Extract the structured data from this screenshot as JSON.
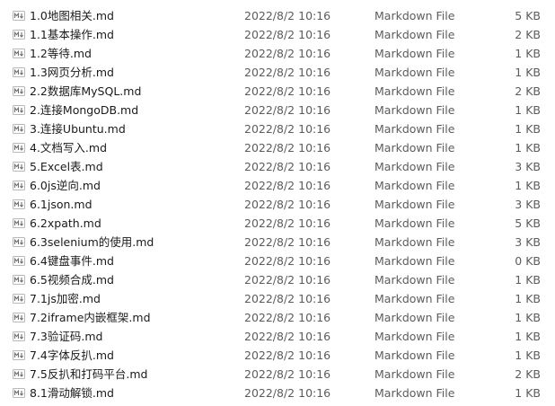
{
  "file_list": {
    "icon": "markdown-file-icon",
    "files": [
      {
        "name": "1.0地图相关.md",
        "modified": "2022/8/2 10:16",
        "type": "Markdown File",
        "size": "5 KB"
      },
      {
        "name": "1.1基本操作.md",
        "modified": "2022/8/2 10:16",
        "type": "Markdown File",
        "size": "2 KB"
      },
      {
        "name": "1.2等待.md",
        "modified": "2022/8/2 10:16",
        "type": "Markdown File",
        "size": "1 KB"
      },
      {
        "name": "1.3网页分析.md",
        "modified": "2022/8/2 10:16",
        "type": "Markdown File",
        "size": "1 KB"
      },
      {
        "name": "2.2数据库MySQL.md",
        "modified": "2022/8/2 10:16",
        "type": "Markdown File",
        "size": "2 KB"
      },
      {
        "name": "2.连接MongoDB.md",
        "modified": "2022/8/2 10:16",
        "type": "Markdown File",
        "size": "1 KB"
      },
      {
        "name": "3.连接Ubuntu.md",
        "modified": "2022/8/2 10:16",
        "type": "Markdown File",
        "size": "1 KB"
      },
      {
        "name": "4.文档写入.md",
        "modified": "2022/8/2 10:16",
        "type": "Markdown File",
        "size": "1 KB"
      },
      {
        "name": "5.Excel表.md",
        "modified": "2022/8/2 10:16",
        "type": "Markdown File",
        "size": "3 KB"
      },
      {
        "name": "6.0js逆向.md",
        "modified": "2022/8/2 10:16",
        "type": "Markdown File",
        "size": "1 KB"
      },
      {
        "name": "6.1json.md",
        "modified": "2022/8/2 10:16",
        "type": "Markdown File",
        "size": "3 KB"
      },
      {
        "name": "6.2xpath.md",
        "modified": "2022/8/2 10:16",
        "type": "Markdown File",
        "size": "5 KB"
      },
      {
        "name": "6.3selenium的使用.md",
        "modified": "2022/8/2 10:16",
        "type": "Markdown File",
        "size": "3 KB"
      },
      {
        "name": "6.4键盘事件.md",
        "modified": "2022/8/2 10:16",
        "type": "Markdown File",
        "size": "0 KB"
      },
      {
        "name": "6.5视频合成.md",
        "modified": "2022/8/2 10:16",
        "type": "Markdown File",
        "size": "1 KB"
      },
      {
        "name": "7.1js加密.md",
        "modified": "2022/8/2 10:16",
        "type": "Markdown File",
        "size": "1 KB"
      },
      {
        "name": "7.2iframe内嵌框架.md",
        "modified": "2022/8/2 10:16",
        "type": "Markdown File",
        "size": "1 KB"
      },
      {
        "name": "7.3验证码.md",
        "modified": "2022/8/2 10:16",
        "type": "Markdown File",
        "size": "1 KB"
      },
      {
        "name": "7.4字体反扒.md",
        "modified": "2022/8/2 10:16",
        "type": "Markdown File",
        "size": "1 KB"
      },
      {
        "name": "7.5反扒和打码平台.md",
        "modified": "2022/8/2 10:16",
        "type": "Markdown File",
        "size": "2 KB"
      },
      {
        "name": "8.1滑动解锁.md",
        "modified": "2022/8/2 10:16",
        "type": "Markdown File",
        "size": "1 KB"
      }
    ]
  }
}
